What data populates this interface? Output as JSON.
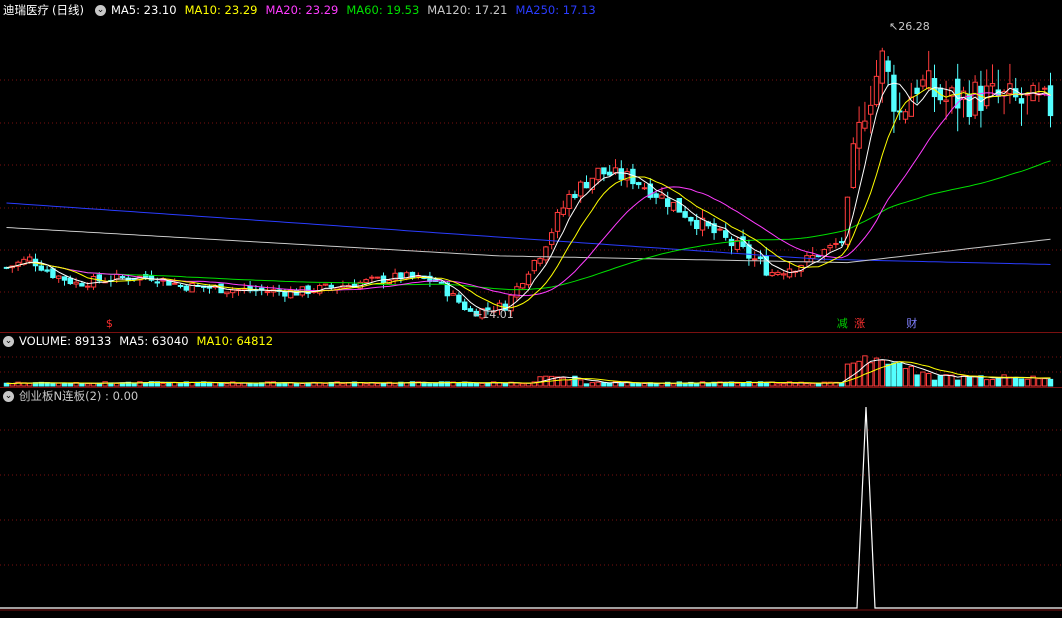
{
  "stock": {
    "name": "迪瑞医疗",
    "period": "(日线)"
  },
  "ma": [
    {
      "label": "MA5",
      "value": "23.10",
      "color": "#ffffff"
    },
    {
      "label": "MA10",
      "value": "23.29",
      "color": "#ffff00"
    },
    {
      "label": "MA20",
      "value": "23.29",
      "color": "#ff3cff"
    },
    {
      "label": "MA60",
      "value": "19.53",
      "color": "#00e000"
    },
    {
      "label": "MA120",
      "value": "17.21",
      "color": "#c8c8c8"
    },
    {
      "label": "MA250",
      "value": "17.13",
      "color": "#2a3cff"
    }
  ],
  "price_annotations": {
    "high": "26.28",
    "low": "14.01"
  },
  "markers": [
    {
      "text": "$",
      "color": "#ff3030",
      "index": 18
    },
    {
      "text": "减",
      "color": "#00d000",
      "index": 144
    },
    {
      "text": "涨",
      "color": "#ff3030",
      "index": 147
    },
    {
      "text": "财",
      "color": "#8080ff",
      "index": 156
    }
  ],
  "volume": {
    "label": "VOLUME",
    "value": "89133",
    "ma5_label": "MA5",
    "ma5_value": "63040",
    "ma10_label": "MA10",
    "ma10_value": "64812"
  },
  "indicator": {
    "label": "创业板N连板(2)",
    "value": "0.00"
  },
  "colors": {
    "up": "#ff3c3c",
    "down": "#54ffff",
    "grid": "#7a1010",
    "bg": "#000000"
  },
  "chart_data": {
    "type": "candlestick",
    "ylim": [
      13.5,
      27.5
    ],
    "ohlc_anchors": [
      [
        0,
        16.3
      ],
      [
        4,
        16.7
      ],
      [
        8,
        16.0
      ],
      [
        12,
        15.6
      ],
      [
        18,
        15.8
      ],
      [
        25,
        15.9
      ],
      [
        30,
        15.5
      ],
      [
        40,
        15.3
      ],
      [
        50,
        15.2
      ],
      [
        58,
        15.5
      ],
      [
        68,
        15.9
      ],
      [
        74,
        15.7
      ],
      [
        80,
        14.3
      ],
      [
        86,
        14.6
      ],
      [
        92,
        17.0
      ],
      [
        97,
        19.5
      ],
      [
        102,
        20.6
      ],
      [
        108,
        20.3
      ],
      [
        114,
        19.3
      ],
      [
        120,
        18.2
      ],
      [
        126,
        17.2
      ],
      [
        132,
        16.1
      ],
      [
        138,
        16.6
      ],
      [
        144,
        17.5
      ],
      [
        146,
        21.0
      ],
      [
        148,
        23.6
      ],
      [
        151,
        25.6
      ],
      [
        154,
        23.2
      ],
      [
        157,
        24.6
      ],
      [
        162,
        23.8
      ],
      [
        168,
        24.0
      ],
      [
        175,
        23.7
      ],
      [
        180,
        23.5
      ]
    ],
    "volume_ylim": [
      0,
      50
    ]
  }
}
